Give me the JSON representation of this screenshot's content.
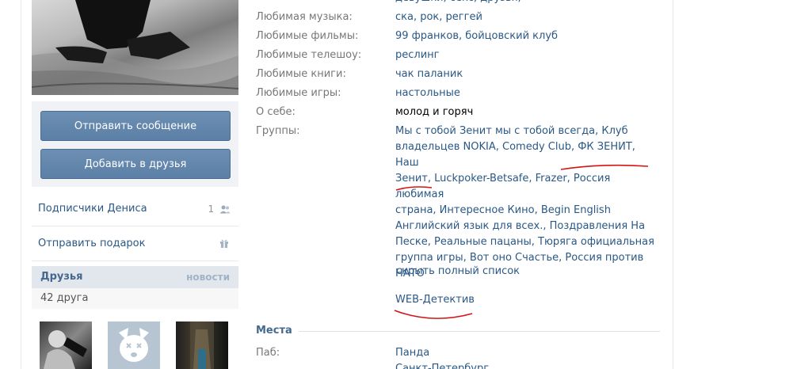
{
  "top_cut_text": "девушки, секс, друзья,",
  "profile_fields": [
    {
      "label": "Любимая музыка:",
      "value": "ска, рок, реггей",
      "link": true
    },
    {
      "label": "Любимые фильмы:",
      "value": "99 франков, бойцовский клуб",
      "link": true
    },
    {
      "label": "Любимые телешоу:",
      "value": "реслинг",
      "link": true
    },
    {
      "label": "Любимые книги:",
      "value": "чак паланик",
      "link": true
    },
    {
      "label": "Любимые игры:",
      "value": "настольные",
      "link": true
    },
    {
      "label": "О себе:",
      "value": "молод и горяч",
      "link": false
    }
  ],
  "groups": {
    "label": "Группы:",
    "lines": [
      "Мы с тобой Зенит мы с тобой всегда, Клуб",
      "владельцев NOKIA, Comedy Club, ФК ЗЕНИТ, Наш",
      "Зенит, Luckpoker-Betsafe, Frazer, Россия любимая",
      "страна, Интересное Кино, Begin English",
      "Английский язык для всех., Поздравления На",
      "Песке, Реальные пацаны, Тюряга официальная",
      "группа игры, Вот оно Счастье, Россия против",
      "НАТО"
    ],
    "hide_link": "скрыть полный список",
    "extra_link": "WEB-Детектив"
  },
  "places": {
    "section_title": "Места",
    "rows": [
      {
        "label": "Паб:",
        "value": "Панда"
      },
      {
        "label": "",
        "value": "Санкт-Петербург"
      }
    ]
  },
  "sidebar": {
    "send_message": "Отправить сообщение",
    "add_friend": "Добавить в друзья",
    "subscribers_label": "Подписчики Дениса",
    "subscribers_count": "1",
    "send_gift": "Отправить подарок",
    "friends_title": "Друзья",
    "friends_news": "новости",
    "friends_count": "42 друга"
  },
  "colors": {
    "link": "#2a5885",
    "label": "#777777",
    "button": "#5e81a8",
    "annotation": "#d41414"
  }
}
